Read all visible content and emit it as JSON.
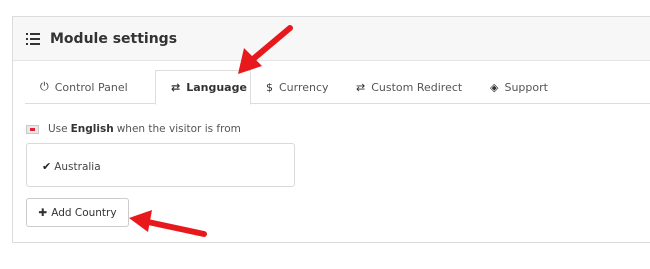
{
  "panel": {
    "title": "Module settings",
    "header_icon": "list-icon"
  },
  "tabs": [
    {
      "label": "Control Panel",
      "icon": "power-icon",
      "glyph": "⏻",
      "active": false
    },
    {
      "label": "Language",
      "icon": "language-icon",
      "glyph": "⇄",
      "active": true
    },
    {
      "label": "Currency",
      "icon": "dollar-icon",
      "glyph": "$",
      "active": false
    },
    {
      "label": "Custom Redirect",
      "icon": "exchange-icon",
      "glyph": "⇄",
      "active": false
    },
    {
      "label": "Support",
      "icon": "ticket-icon",
      "glyph": "◈",
      "active": false
    }
  ],
  "rule": {
    "prefix": "Use",
    "language": "English",
    "suffix": "when the visitor is from",
    "flag_icon": "english-flag-icon"
  },
  "countries": [
    {
      "name": "Australia",
      "icon": "check-icon"
    }
  ],
  "add_button": {
    "label": "Add Country",
    "icon": "plus-icon"
  },
  "colors": {
    "arrow": "#e8191c",
    "panel_header_bg": "#f7f7f7",
    "border": "#dcdcdc"
  }
}
